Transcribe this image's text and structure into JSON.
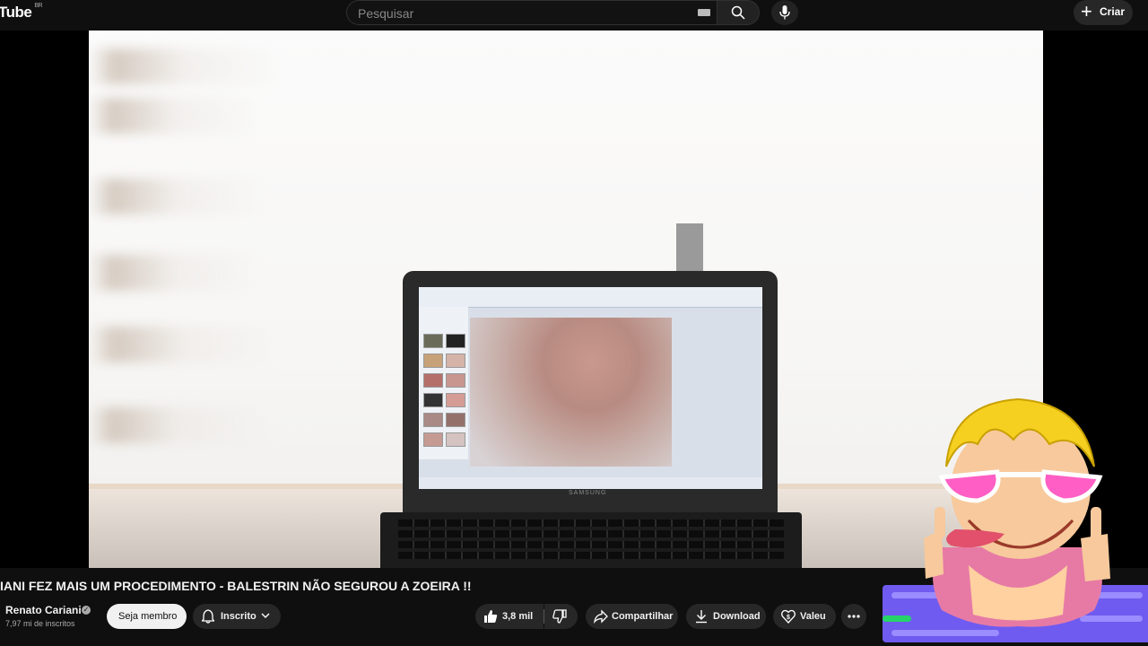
{
  "header": {
    "logo_text": "Tube",
    "logo_region": "BR",
    "search_placeholder": "Pesquisar",
    "create_label": "Criar"
  },
  "video": {
    "screen_brand": "SAMSUNG"
  },
  "title": "IANI FEZ MAIS UM PROCEDIMENTO - BALESTRIN NÃO SEGUROU A ZOEIRA !!",
  "channel": {
    "name": "Renato Cariani",
    "subscribers": "7,97 mi de inscritos",
    "member_label": "Seja membro",
    "subscribed_label": "Inscrito"
  },
  "actions": {
    "likes": "3,8 mil",
    "share_label": "Compartilhar",
    "download_label": "Download",
    "thanks_label": "Valeu"
  },
  "colors": {
    "background": "#0f0f0f",
    "pill": "#272727",
    "overlay_banner": "#6f5bf0"
  }
}
